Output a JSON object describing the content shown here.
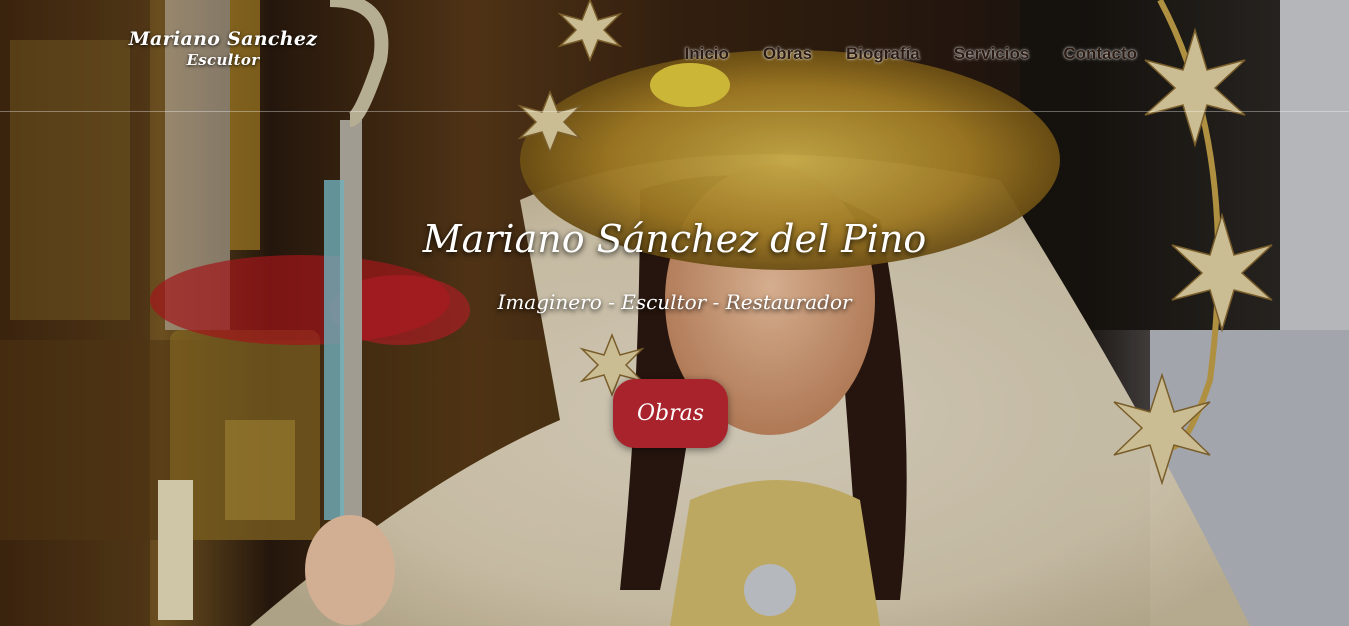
{
  "header": {
    "logo_name": "Mariano Sanchez",
    "logo_sub": "Escultor",
    "nav": [
      {
        "label": "Inicio"
      },
      {
        "label": "Obras"
      },
      {
        "label": "Biografía"
      },
      {
        "label": "Servicios"
      },
      {
        "label": "Contacto"
      }
    ]
  },
  "hero": {
    "title": "Mariano Sánchez del Pino",
    "subtitle": "Imaginero - Escultor - Restaurador",
    "cta_label": "Obras"
  },
  "colors": {
    "accent": "#a8232b",
    "text_light": "#ffffff",
    "nav_text": "#2a1a12"
  }
}
